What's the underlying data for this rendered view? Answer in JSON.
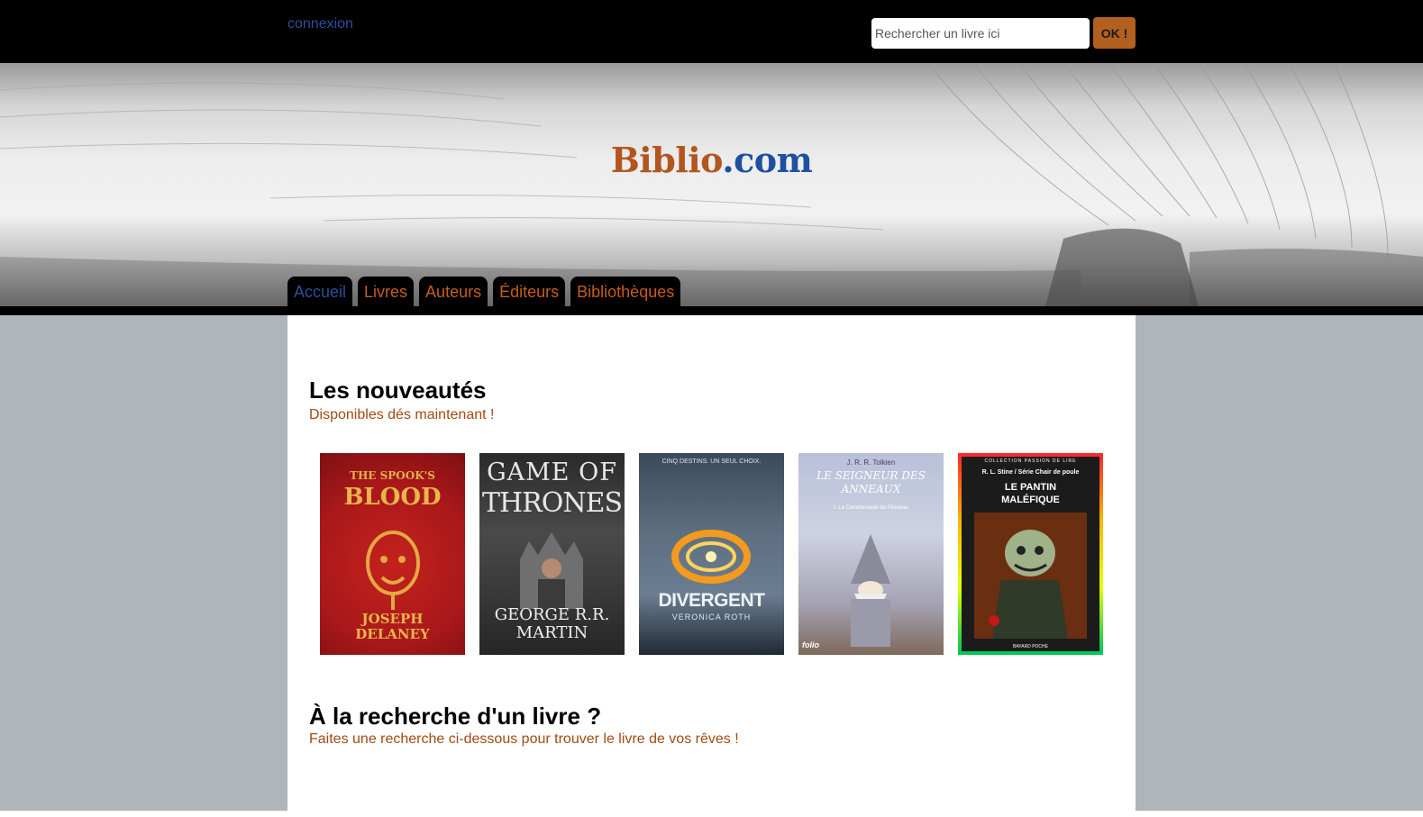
{
  "header": {
    "login_label": "connexion",
    "search_placeholder": "Rechercher un livre ici",
    "search_button": "OK !"
  },
  "logo": {
    "part1": "Biblio",
    "part2": ".com"
  },
  "nav": {
    "tabs": [
      {
        "label": "Accueil",
        "active": true
      },
      {
        "label": "Livres",
        "active": false
      },
      {
        "label": "Auteurs",
        "active": false
      },
      {
        "label": "Éditeurs",
        "active": false
      },
      {
        "label": "Bibliothèques",
        "active": false
      }
    ]
  },
  "new_releases": {
    "title": "Les nouveautés",
    "subtitle": "Disponibles dés maintenant !",
    "books": [
      {
        "line1": "THE SPOOK'S",
        "line2": "BLOOD",
        "author": "JOSEPH DELANEY"
      },
      {
        "line1": "GAME OF",
        "line2": "THRONES",
        "author": "GEORGE R.R. MARTIN"
      },
      {
        "tagline": "CINQ DESTINS. UN SEUL CHOIX.",
        "line2": "DIVERGENT",
        "author": "VERONICA ROTH"
      },
      {
        "author": "J. R. R. Tolkien",
        "line1": "LE SEIGNEUR DES ANNEAUX",
        "line2": "I. La Communauté de l'Anneau",
        "publisher": "folio"
      },
      {
        "collection": "COLLECTION PASSION DE LIRE",
        "author": "R. L. Stine / Série Chair de poule",
        "line1": "LE PANTIN",
        "line2": "MALÉFIQUE",
        "publisher": "BAYARD POCHE"
      }
    ]
  },
  "search_section": {
    "title": "À la recherche d'un livre ?",
    "subtitle": "Faites une recherche ci-dessous pour trouver le livre de vos rêves !"
  },
  "colors": {
    "accent_orange": "#c65d19",
    "link_blue": "#2a4f9c",
    "side_gray": "#b0b5b9"
  }
}
